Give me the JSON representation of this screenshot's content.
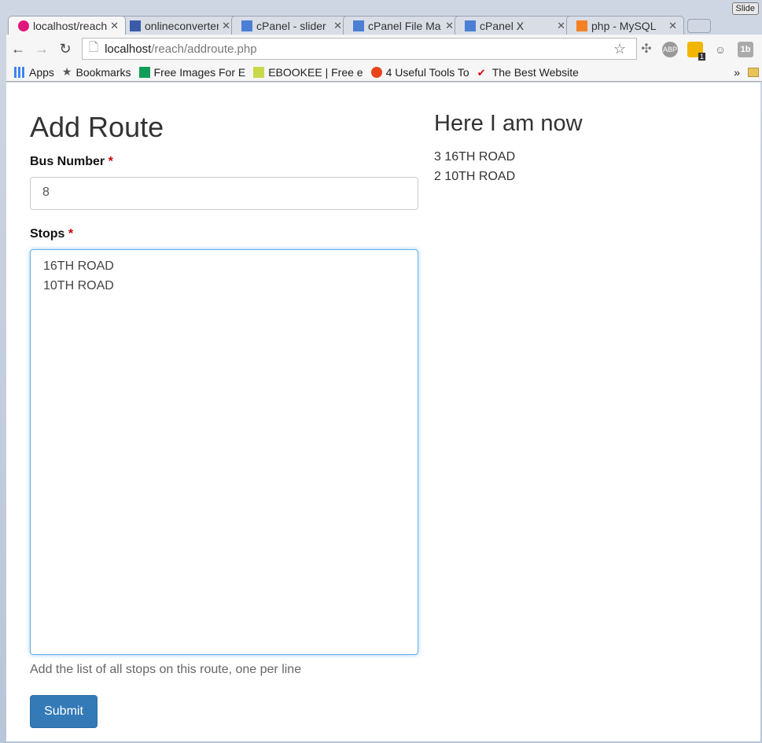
{
  "browser": {
    "slide_label": "Slide",
    "tabs": [
      {
        "title": "localhost/reach",
        "icon": "wamp-icon",
        "color": "#e0177c",
        "active": true
      },
      {
        "title": "onlineconverter",
        "icon": "grid-icon",
        "color": "#3a5ca8"
      },
      {
        "title": "cPanel - slider",
        "icon": "cpanel-icon",
        "color": "#4a7fd4"
      },
      {
        "title": "cPanel File Ma",
        "icon": "cpanel-icon",
        "color": "#4a7fd4"
      },
      {
        "title": "cPanel X",
        "icon": "cpanel-icon",
        "color": "#4a7fd4"
      },
      {
        "title": "php - MySQL",
        "icon": "stackoverflow-icon",
        "color": "#f48024"
      }
    ],
    "url_host": "localhost",
    "url_path": "/reach/addroute.php",
    "extensions": [
      {
        "name": "abp-icon",
        "label": "ABP"
      },
      {
        "name": "extension-badge-icon",
        "label": "1"
      },
      {
        "name": "panda-icon",
        "label": ""
      },
      {
        "name": "1b-icon",
        "label": "1b"
      }
    ],
    "bookmarks": [
      {
        "label": "Apps",
        "icon": "apps-icon",
        "color": "#4285f4"
      },
      {
        "label": "Bookmarks",
        "icon": "star-icon",
        "color": "#555"
      },
      {
        "label": "Free Images For E",
        "icon": "sheets-icon",
        "color": "#0f9d58"
      },
      {
        "label": "EBOOKEE | Free e",
        "icon": "ebookee-icon",
        "color": "#2a5b9c"
      },
      {
        "label": "4 Useful Tools To",
        "icon": "bd-icon",
        "color": "#e8441c"
      },
      {
        "label": "The Best Website",
        "icon": "gmail-check-icon",
        "color": "#d00"
      }
    ],
    "overflow": "»"
  },
  "form": {
    "title": "Add Route",
    "bus_label": "Bus Number",
    "required_mark": "*",
    "bus_value": "8",
    "stops_label": "Stops",
    "stops": [
      "16TH ROAD",
      "10TH ROAD"
    ],
    "help": "Add the list of all stops on this route, one per line",
    "submit": "Submit"
  },
  "status": {
    "title": "Here I am now",
    "lines": [
      "3 16TH ROAD",
      "2 10TH ROAD"
    ]
  }
}
